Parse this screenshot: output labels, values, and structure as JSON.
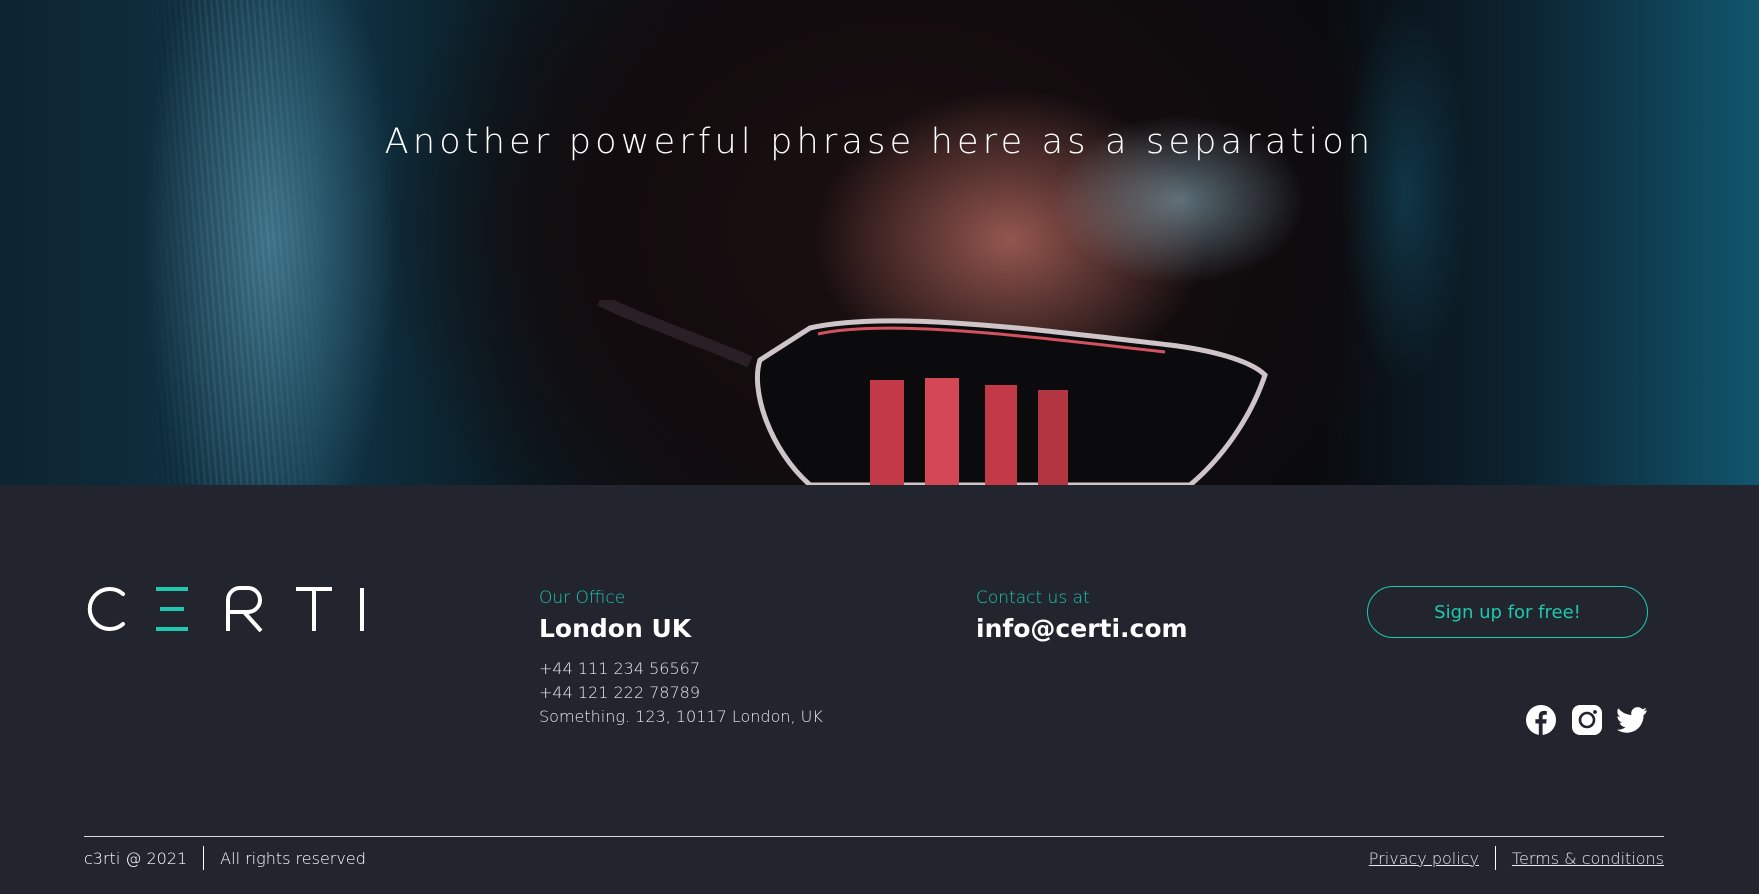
{
  "hero": {
    "phrase": "Another powerful phrase here as a separation"
  },
  "brand": {
    "logo_text": "CERTI",
    "accent_color": "#1fc8b0"
  },
  "office": {
    "label": "Our Office",
    "city": "London UK",
    "phone_1": "+44 111 234 56567",
    "phone_2": "+44 121 222 78789",
    "address": "Something. 123, 10117 London, UK"
  },
  "contact": {
    "label": "Contact us at",
    "email": "info@certi.com"
  },
  "cta": {
    "signup_label": "Sign up for free!"
  },
  "social": {
    "icons": [
      "facebook-icon",
      "instagram-icon",
      "twitter-icon"
    ]
  },
  "bottom_bar": {
    "copyright": "c3rti @ 2021",
    "rights": "All rights reserved",
    "privacy_label": "Privacy policy",
    "terms_label": "Terms & conditions"
  },
  "colors": {
    "footer_bg": "#22252d",
    "accent": "#1fc8b0",
    "text": "#ffffff"
  }
}
